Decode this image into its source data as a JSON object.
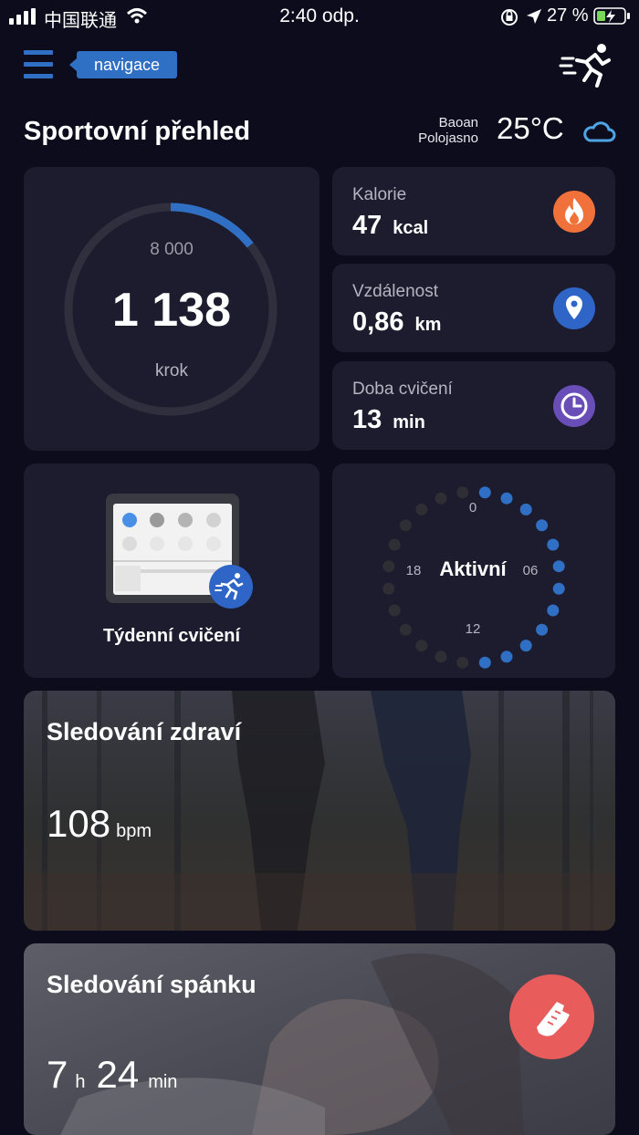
{
  "status_bar": {
    "carrier": "中国联通",
    "time": "2:40 odp.",
    "battery": "27 %"
  },
  "header": {
    "nav_label": "navigace",
    "title": "Sportovní přehled"
  },
  "weather": {
    "city": "Baoan",
    "condition": "Polojasno",
    "temperature": "25°C"
  },
  "steps": {
    "goal": "8 000",
    "count": "1 138",
    "unit": "krok",
    "progress": 0.142
  },
  "stats": [
    {
      "label": "Kalorie",
      "value": "47",
      "unit": "kcal",
      "icon": "flame-icon",
      "color": "#f0723a"
    },
    {
      "label": "Vzdálenost",
      "value": "0,86",
      "unit": "km",
      "icon": "location-pin-icon",
      "color": "#2f65c7"
    },
    {
      "label": "Doba cvičení",
      "value": "13",
      "unit": "min",
      "icon": "clock-icon",
      "color": "#6a4eb8"
    }
  ],
  "weekly": {
    "label": "Týdenní cvičení"
  },
  "activity": {
    "label": "Aktivní",
    "ticks": [
      "0",
      "06",
      "12",
      "18"
    ]
  },
  "health": {
    "title": "Sledování zdraví",
    "value": "108",
    "unit": "bpm"
  },
  "sleep": {
    "title": "Sledování spánku",
    "hours": "7",
    "hours_unit": "h",
    "minutes": "24",
    "minutes_unit": "min"
  },
  "colors": {
    "background": "#0d0c1c",
    "card": "#1d1c2e",
    "accent": "#2f6fc4",
    "fab": "#e85c5c"
  }
}
